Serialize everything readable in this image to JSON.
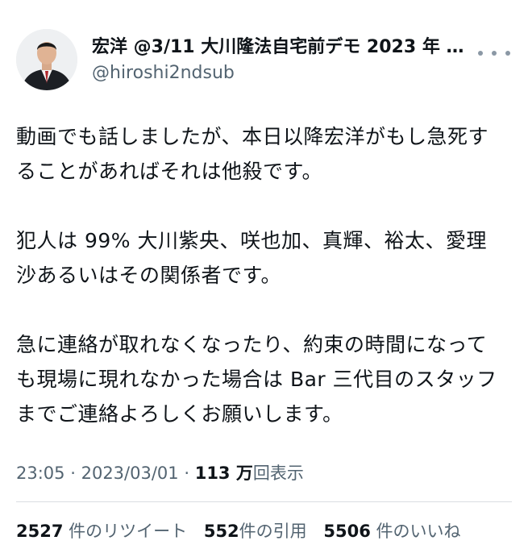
{
  "author": {
    "display_name": "宏洋 @3/11 大川隆法自宅前デモ 2023 年 4...",
    "handle": "@hiroshi2ndsub"
  },
  "icons": {
    "avatar": "profile-photo",
    "more": "more-horizontal-icon"
  },
  "tweet": {
    "paragraphs": [
      {
        "lines": [
          "動画でも話しましたが、本日以降宏洋がもし急死す",
          "ることがあればそれは他殺です。"
        ]
      },
      {
        "lines": [
          "犯人は 99% 大川紫央、咲也加、真輝、裕太、愛理",
          "沙あるいはその関係者です。"
        ]
      },
      {
        "lines": [
          "急に連絡が取れなくなったり、約束の時間になって",
          "も現場に現れなかった場合は Bar 三代目のスタッフ",
          "までご連絡よろしくお願いします。"
        ]
      }
    ]
  },
  "meta": {
    "time": "23:05",
    "separator": "·",
    "date": "2023/03/01",
    "views_count": "113 万",
    "views_label": "回表示"
  },
  "stats": {
    "retweets": {
      "count": "2527",
      "label": "件のリツイート"
    },
    "quotes": {
      "count": "552",
      "label": "件の引用"
    },
    "likes": {
      "count": "5506",
      "label": "件のいいね"
    }
  },
  "colors": {
    "text": "#0f1419",
    "secondary": "#536471",
    "divider": "#d9dde1",
    "background": "#ffffff"
  }
}
